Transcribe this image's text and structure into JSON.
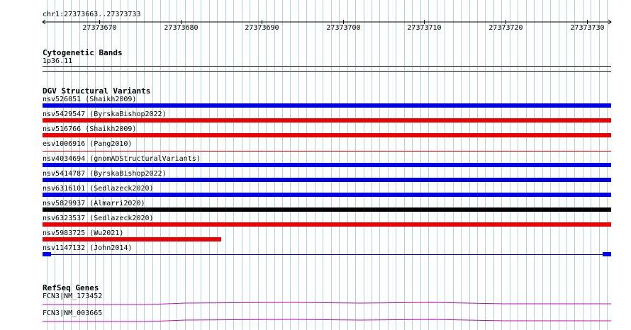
{
  "location": {
    "label": "chr1:27373663..27373733"
  },
  "ruler": {
    "ticks": [
      "27373670",
      "27373680",
      "27373690",
      "27373700",
      "27373710",
      "27373720",
      "27373730"
    ],
    "tick_positions": [
      27373670,
      27373680,
      27373690,
      27373700,
      27373710,
      27373720,
      27373730
    ],
    "start": 27373663,
    "end": 27373733
  },
  "tracks": {
    "cytoband": {
      "title": "Cytogenetic Bands",
      "band": "1p36.11"
    },
    "dgv": {
      "title": "DGV Structural Variants",
      "colors": {
        "gain": "#0000ee",
        "loss": "#ee0000",
        "gain_loss": "#000000"
      },
      "items": [
        {
          "label": "nsv526051 (Shaikh2009)",
          "color": "#0000ee",
          "style": "bar",
          "start": 27373663,
          "end": 27373733
        },
        {
          "label": "nsv5429547 (ByrskaBishop2022)",
          "color": "#ee0000",
          "style": "bar",
          "start": 27373663,
          "end": 27373733
        },
        {
          "label": "nsv516766 (Shaikh2009)",
          "color": "#ee0000",
          "style": "bar",
          "start": 27373663,
          "end": 27373733
        },
        {
          "label": "esv1006916 (Pang2010)",
          "color": "#ee0000",
          "style": "line",
          "start": 27373663,
          "end": 27373733
        },
        {
          "label": "nsv4034694 (gnomADStructuralVariants)",
          "color": "#0000ee",
          "style": "bar",
          "start": 27373663,
          "end": 27373733
        },
        {
          "label": "nsv5414787 (ByrskaBishop2022)",
          "color": "#0000ee",
          "style": "bar",
          "start": 27373663,
          "end": 27373733
        },
        {
          "label": "nsv6316101 (Sedlazeck2020)",
          "color": "#0000ee",
          "style": "bar",
          "start": 27373663,
          "end": 27373733
        },
        {
          "label": "nsv5829937 (Almarri2020)",
          "color": "#000000",
          "style": "bar",
          "start": 27373663,
          "end": 27373733
        },
        {
          "label": "nsv6323537 (Sedlazeck2020)",
          "color": "#ee0000",
          "style": "bar",
          "start": 27373663,
          "end": 27373733
        },
        {
          "label": "nsv5983725 (Wu2021)",
          "color": "#ee0000",
          "style": "bar",
          "start": 27373663,
          "end": 27373685
        },
        {
          "label": "nsv1147132 (John2014)",
          "color": "#0000ee",
          "style": "ends",
          "start": 27373663,
          "end": 27373733
        }
      ]
    },
    "refseq": {
      "title": "RefSeq Genes",
      "color": "#cc00cc",
      "items": [
        {
          "label": "FCN3|NM_173452"
        },
        {
          "label": "FCN3|NM_003665"
        }
      ]
    }
  }
}
